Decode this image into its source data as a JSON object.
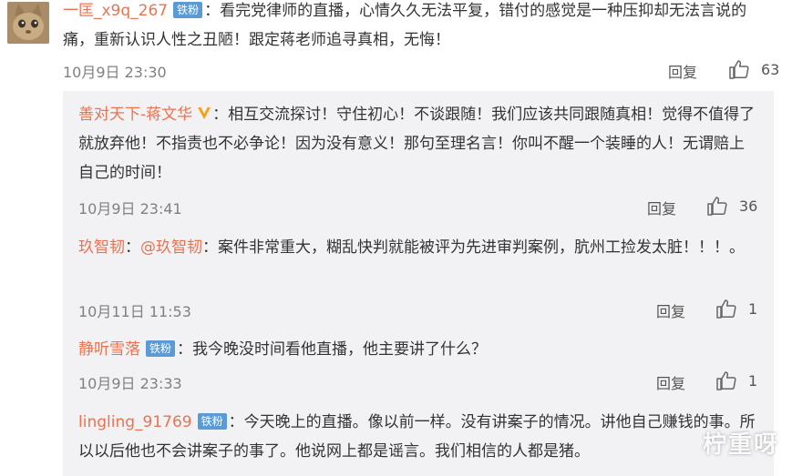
{
  "main_comment": {
    "username": "一匡_x9q_267",
    "badge": "铁粉",
    "text": "看完党律师的直播，心情久久无法平复，错付的感觉是一种压抑却无法言说的痛，重新认识人性之丑陋！跟定蒋老师追寻真相，无悔！",
    "timestamp": "10月9日 23:30",
    "reply_label": "回复",
    "likes": "63"
  },
  "replies": [
    {
      "username": "善对天下-蒋文华",
      "verified": true,
      "text": "相互交流探讨！守住初心！不谈跟随！我们应该共同跟随真相！觉得不值得了就放弃他！不指责也不必争论！因为没有意义！那句至理名言！你叫不醒一个装睡的人！无谓赔上自己的时间！",
      "timestamp": "10月9日 23:41",
      "reply_label": "回复",
      "likes": "36"
    },
    {
      "username": "玖智韧",
      "mention": "@玖智韧",
      "text": "案件非常重大，糊乱快判就能被评为先进审判案例，肮州工捡发太脏！！！。",
      "timestamp": "10月11日 11:53",
      "reply_label": "回复",
      "likes": "1"
    },
    {
      "username": "静听雪落",
      "badge": "铁粉",
      "text": "我今晚没时间看他直播，他主要讲了什么？",
      "timestamp": "10月9日 23:33",
      "reply_label": "回复",
      "likes": "1"
    },
    {
      "username": "lingling_91769",
      "badge": "铁粉",
      "text": "今天晚上的直播。像以前一样。没有讲案子的情况。讲他自己赚钱的事。所以以后他也不会讲案子的事了。他说网上都是谣言。我们相信的人都是猪。"
    }
  ],
  "watermark": "柠重呀",
  "colors": {
    "username": "#eb7350",
    "badge": "#5a9bd5",
    "verified": "#f4a21b",
    "reply_bg": "#f2f2f5"
  }
}
